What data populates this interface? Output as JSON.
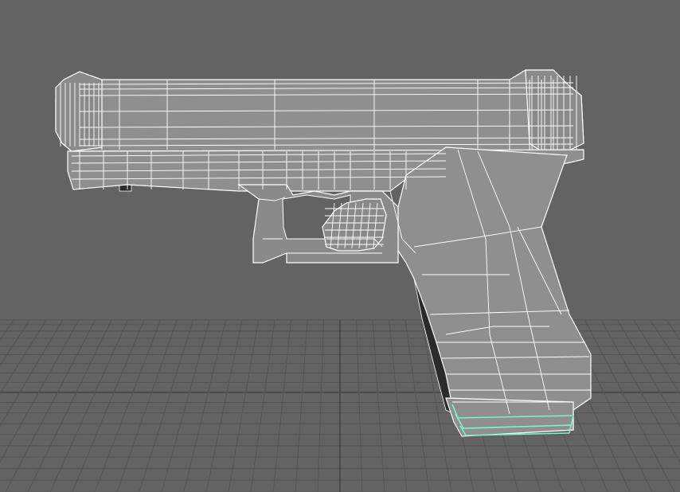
{
  "viewport": {
    "background": "#636363",
    "grid_color": "#545454",
    "grid_major_color": "#3f3f3f",
    "wire_color": "#ffffff",
    "selection_color": "#7ff2c8",
    "surface_color": "#8e8e8e",
    "surface_dark_color": "#7a7a7a",
    "shadow_color": "#2a2a2a"
  },
  "scene": {
    "object": "pistol-wireframe-model",
    "selected_part": "magazine-baseplate-edge-loop"
  }
}
